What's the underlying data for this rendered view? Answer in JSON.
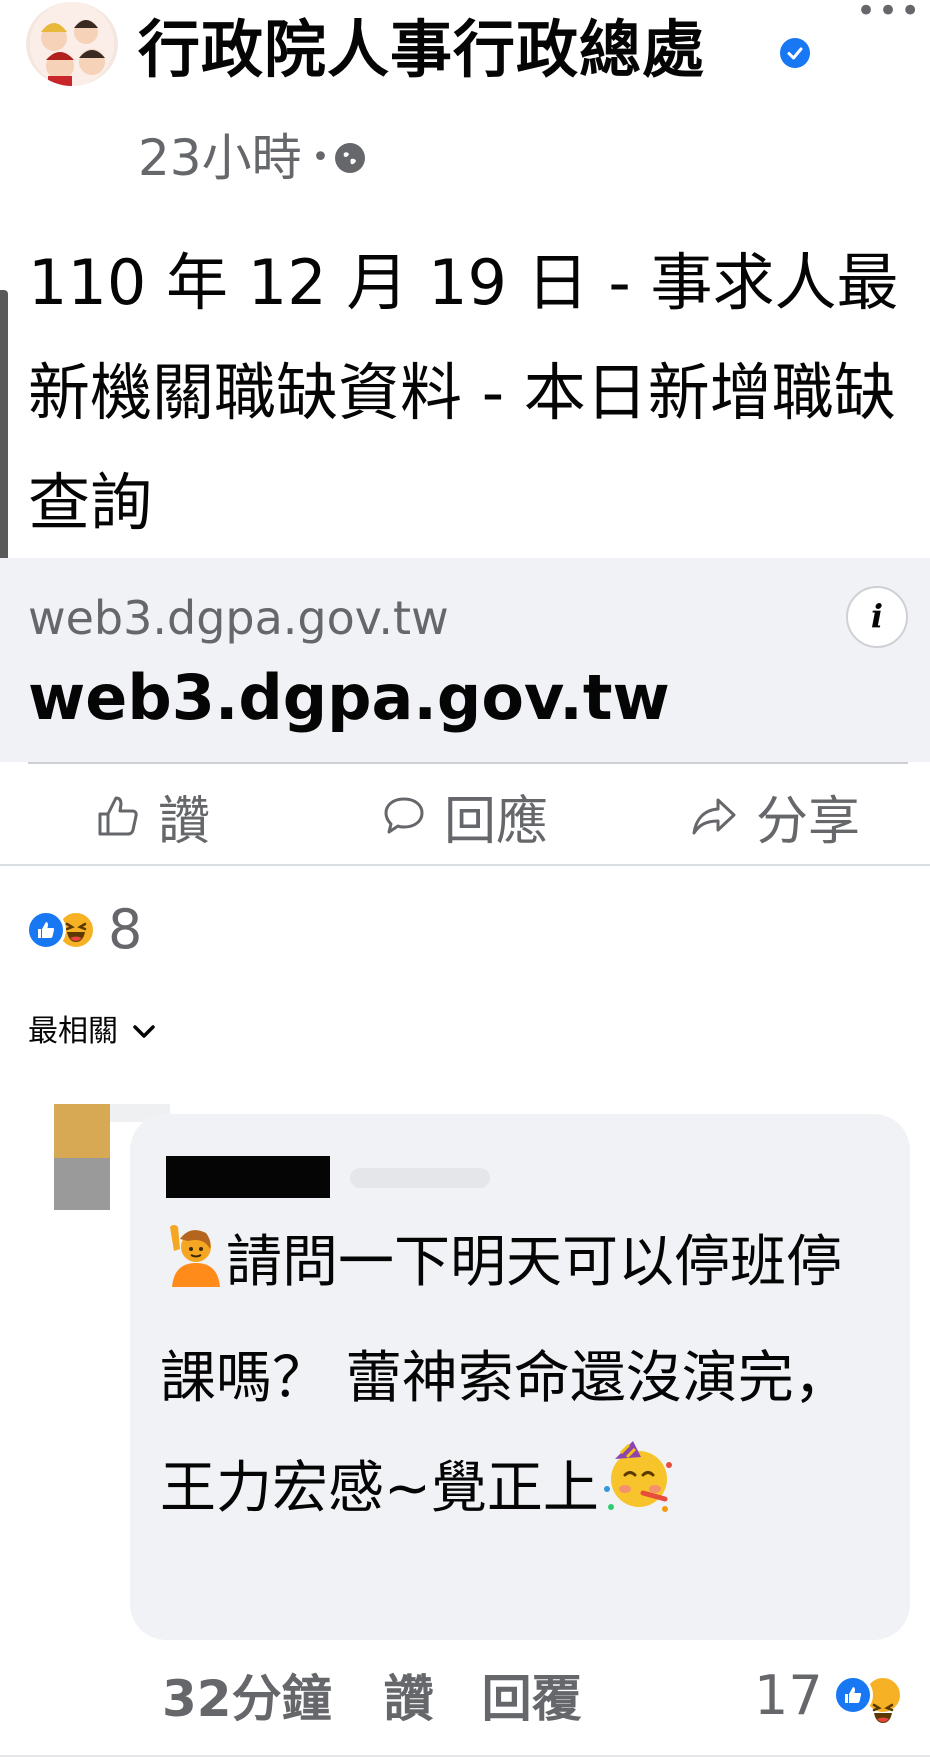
{
  "header": {
    "page_name": "行政院人事行政總處",
    "time": "23小時",
    "dot": "•",
    "more": "•••",
    "avatar_icon": "page-avatar-cartoon",
    "verified_icon": "verified-badge-icon",
    "audience_icon": "globe-icon"
  },
  "post": {
    "text": "110 年 12 月 19 日 - 事求人最新機關職缺資料 - 本日新增職缺查詢"
  },
  "link_preview": {
    "domain": "web3.dgpa.gov.tw",
    "title": "web3.dgpa.gov.tw",
    "info": "i"
  },
  "actions": {
    "like": "讚",
    "comment": "回應",
    "share": "分享"
  },
  "reactions": {
    "count": "8",
    "types": [
      "like",
      "haha"
    ]
  },
  "sort": {
    "label": "最相關"
  },
  "comment": {
    "text_line1": "請問一下明天可以停班停課嗎？  蕾神索命還沒演完，王力宏感~覺正上",
    "leading_emoji": "🙋",
    "trailing_emoji": "🥳",
    "time": "32分鐘",
    "like": "讚",
    "reply": "回覆",
    "reaction_count": "17"
  },
  "colors": {
    "accent": "#1877f2",
    "secondary_text": "#65676b",
    "bubble": "#f0f2f5",
    "haha": "#f7b125"
  }
}
